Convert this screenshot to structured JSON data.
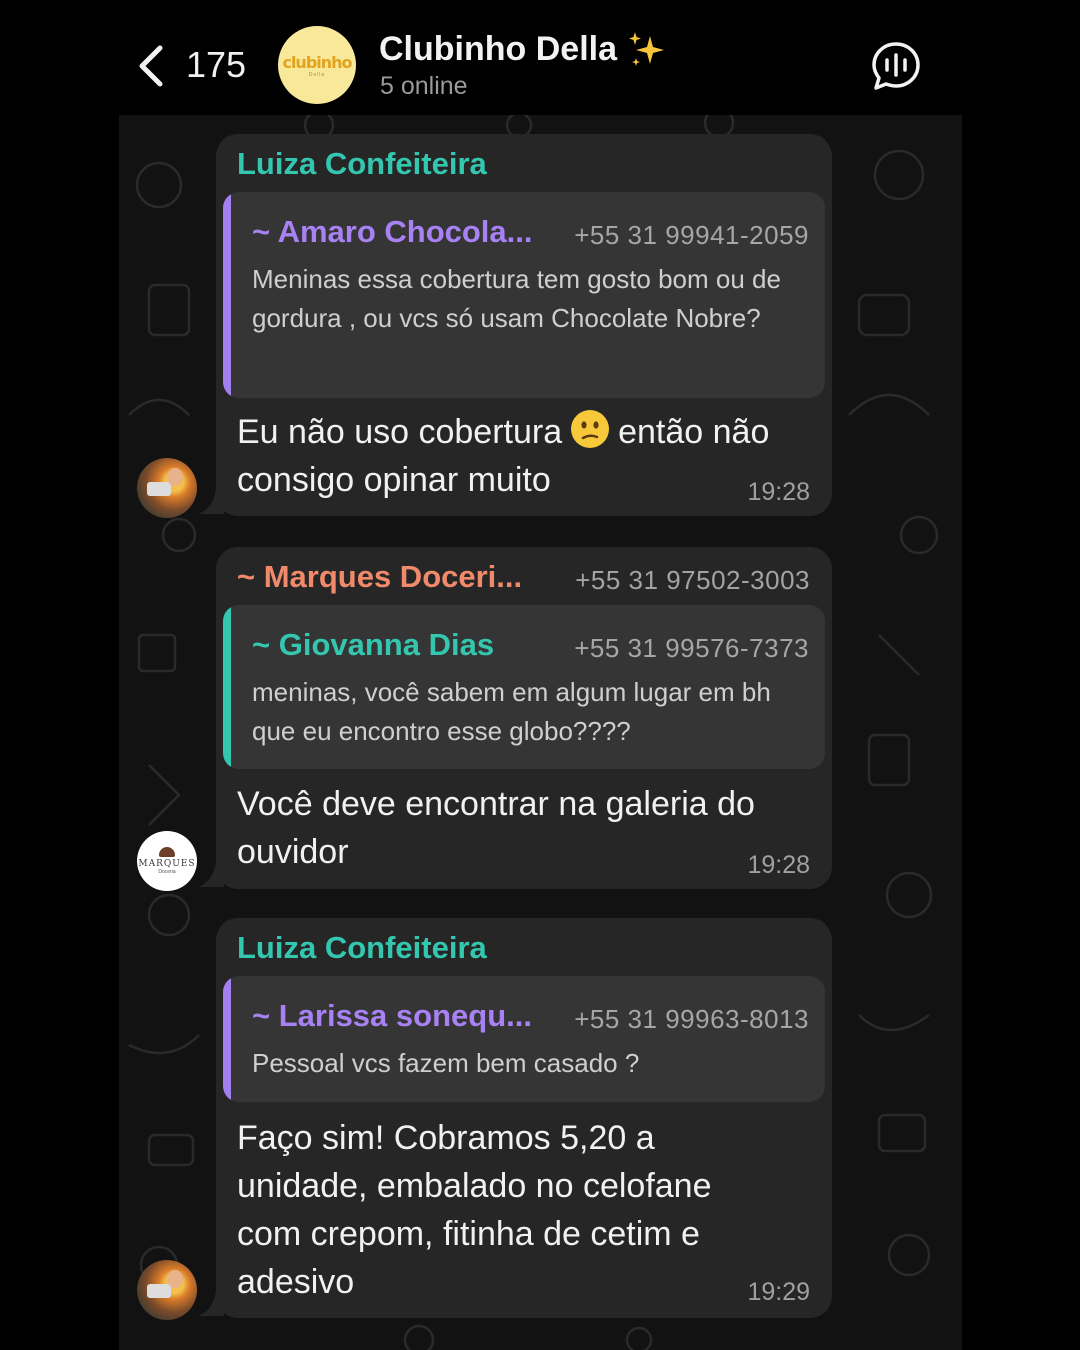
{
  "header": {
    "back_count": "175",
    "group_name": "Clubinho Della",
    "status": "5 online",
    "avatar_text": "clubinho",
    "avatar_subtext": "Della"
  },
  "messages": [
    {
      "sender": "Luiza Confeiteira",
      "sender_color": "#34c7b0",
      "quote": {
        "name": "~ Amaro Chocola...",
        "phone": "+55 31 99941-2059",
        "text": "Meninas essa cobertura tem gosto bom ou de gordura , ou vcs só usam Chocolate Nobre?",
        "bar_color": "#a47ff0",
        "name_color": "#a882f5"
      },
      "text_before_emoji": "Eu não uso cobertura",
      "emoji": "confused-face",
      "text_after_emoji": "então não consigo opinar muito",
      "time": "19:28"
    },
    {
      "sender": "~ Marques Doceri...",
      "sender_phone": "+55 31 97502-3003",
      "sender_color": "#f08a6b",
      "quote": {
        "name": "~ Giovanna Dias",
        "phone": "+55 31 99576-7373",
        "text": "meninas, você sabem em algum lugar em bh que eu encontro esse globo????",
        "bar_color": "#34c7b0",
        "name_color": "#34c7b0"
      },
      "text": "Você deve encontrar na galeria do ouvidor",
      "time": "19:28"
    },
    {
      "sender": "Luiza Confeiteira",
      "sender_color": "#34c7b0",
      "quote": {
        "name": "~ Larissa sonequ...",
        "phone": "+55 31 99963-8013",
        "text": "Pessoal vcs fazem bem casado ?",
        "bar_color": "#a47ff0",
        "name_color": "#a882f5"
      },
      "text": "Faço sim! Cobramos 5,20 a unidade, embalado no celofane com crepom, fitinha de cetim e adesivo",
      "time": "19:29"
    }
  ],
  "avatars": {
    "marques_text": "MARQUES",
    "marques_sub": "Doceria"
  },
  "colors": {
    "background": "#000000",
    "wallpaper": "#121212",
    "bubble": "#262626",
    "quote_bg": "#353535"
  }
}
